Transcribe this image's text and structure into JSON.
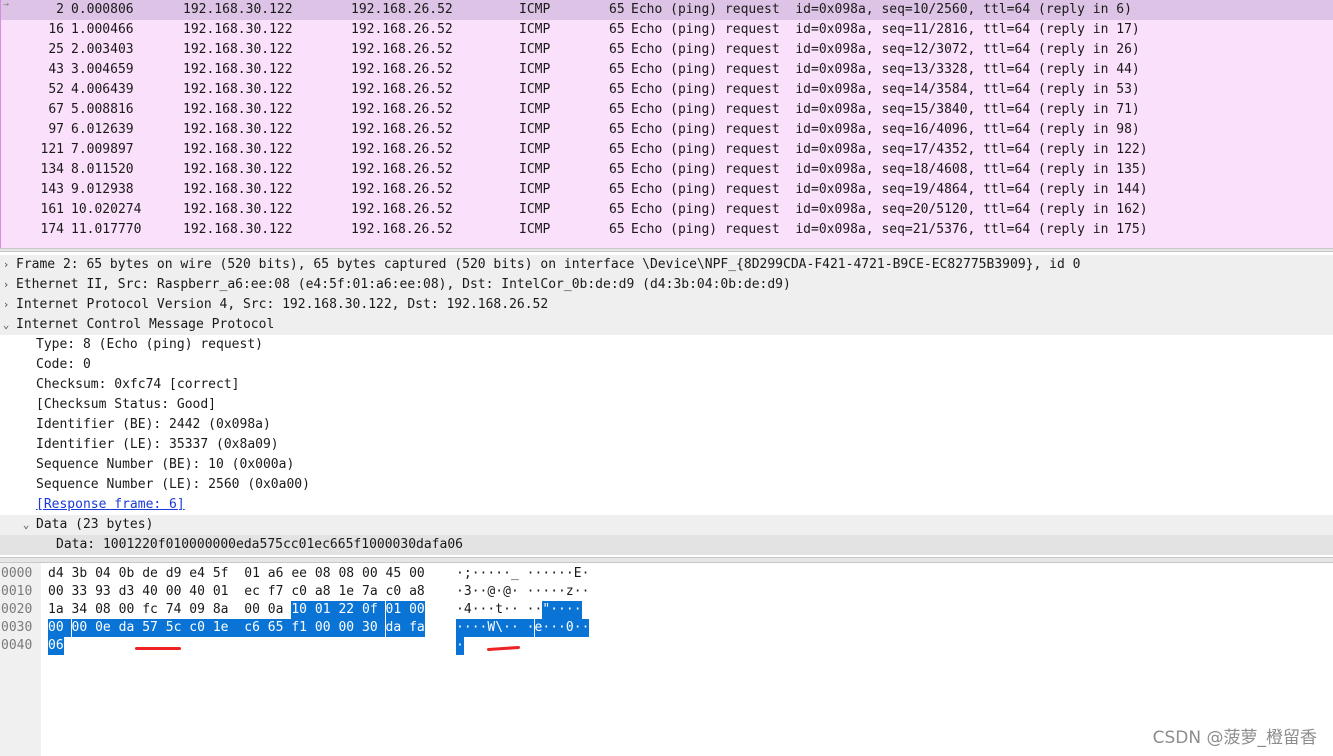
{
  "packets": [
    {
      "no": "2",
      "time": "0.000806",
      "src": "192.168.30.122",
      "dst": "192.168.26.52",
      "proto": "ICMP",
      "len": "65",
      "info": "Echo (ping) request  id=0x098a, seq=10/2560, ttl=64 (reply in 6)",
      "selected": true
    },
    {
      "no": "16",
      "time": "1.000466",
      "src": "192.168.30.122",
      "dst": "192.168.26.52",
      "proto": "ICMP",
      "len": "65",
      "info": "Echo (ping) request  id=0x098a, seq=11/2816, ttl=64 (reply in 17)"
    },
    {
      "no": "25",
      "time": "2.003403",
      "src": "192.168.30.122",
      "dst": "192.168.26.52",
      "proto": "ICMP",
      "len": "65",
      "info": "Echo (ping) request  id=0x098a, seq=12/3072, ttl=64 (reply in 26)"
    },
    {
      "no": "43",
      "time": "3.004659",
      "src": "192.168.30.122",
      "dst": "192.168.26.52",
      "proto": "ICMP",
      "len": "65",
      "info": "Echo (ping) request  id=0x098a, seq=13/3328, ttl=64 (reply in 44)"
    },
    {
      "no": "52",
      "time": "4.006439",
      "src": "192.168.30.122",
      "dst": "192.168.26.52",
      "proto": "ICMP",
      "len": "65",
      "info": "Echo (ping) request  id=0x098a, seq=14/3584, ttl=64 (reply in 53)"
    },
    {
      "no": "67",
      "time": "5.008816",
      "src": "192.168.30.122",
      "dst": "192.168.26.52",
      "proto": "ICMP",
      "len": "65",
      "info": "Echo (ping) request  id=0x098a, seq=15/3840, ttl=64 (reply in 71)"
    },
    {
      "no": "97",
      "time": "6.012639",
      "src": "192.168.30.122",
      "dst": "192.168.26.52",
      "proto": "ICMP",
      "len": "65",
      "info": "Echo (ping) request  id=0x098a, seq=16/4096, ttl=64 (reply in 98)"
    },
    {
      "no": "121",
      "time": "7.009897",
      "src": "192.168.30.122",
      "dst": "192.168.26.52",
      "proto": "ICMP",
      "len": "65",
      "info": "Echo (ping) request  id=0x098a, seq=17/4352, ttl=64 (reply in 122)"
    },
    {
      "no": "134",
      "time": "8.011520",
      "src": "192.168.30.122",
      "dst": "192.168.26.52",
      "proto": "ICMP",
      "len": "65",
      "info": "Echo (ping) request  id=0x098a, seq=18/4608, ttl=64 (reply in 135)"
    },
    {
      "no": "143",
      "time": "9.012938",
      "src": "192.168.30.122",
      "dst": "192.168.26.52",
      "proto": "ICMP",
      "len": "65",
      "info": "Echo (ping) request  id=0x098a, seq=19/4864, ttl=64 (reply in 144)"
    },
    {
      "no": "161",
      "time": "10.020274",
      "src": "192.168.30.122",
      "dst": "192.168.26.52",
      "proto": "ICMP",
      "len": "65",
      "info": "Echo (ping) request  id=0x098a, seq=20/5120, ttl=64 (reply in 162)"
    },
    {
      "no": "174",
      "time": "11.017770",
      "src": "192.168.30.122",
      "dst": "192.168.26.52",
      "proto": "ICMP",
      "len": "65",
      "info": "Echo (ping) request  id=0x098a, seq=21/5376, ttl=64 (reply in 175)"
    }
  ],
  "details": [
    {
      "text": "Frame 2: 65 bytes on wire (520 bits), 65 bytes captured (520 bits) on interface \\Device\\NPF_{8D299CDA-F421-4721-B9CE-EC82775B3909}, id 0",
      "level": 0,
      "toggle": ">",
      "hl": true
    },
    {
      "text": "Ethernet II, Src: Raspberr_a6:ee:08 (e4:5f:01:a6:ee:08), Dst: IntelCor_0b:de:d9 (d4:3b:04:0b:de:d9)",
      "level": 0,
      "toggle": ">",
      "hl": true
    },
    {
      "text": "Internet Protocol Version 4, Src: 192.168.30.122, Dst: 192.168.26.52",
      "level": 0,
      "toggle": ">",
      "hl": true
    },
    {
      "text": "Internet Control Message Protocol",
      "level": 0,
      "toggle": "v",
      "hl": true
    },
    {
      "text": "Type: 8 (Echo (ping) request)",
      "level": 1
    },
    {
      "text": "Code: 0",
      "level": 1
    },
    {
      "text": "Checksum: 0xfc74 [correct]",
      "level": 1
    },
    {
      "text": "[Checksum Status: Good]",
      "level": 1
    },
    {
      "text": "Identifier (BE): 2442 (0x098a)",
      "level": 1
    },
    {
      "text": "Identifier (LE): 35337 (0x8a09)",
      "level": 1
    },
    {
      "text": "Sequence Number (BE): 10 (0x000a)",
      "level": 1
    },
    {
      "text": "Sequence Number (LE): 2560 (0x0a00)",
      "level": 1
    },
    {
      "text": "[Response frame: 6]",
      "level": 1,
      "link": true
    },
    {
      "text": "Data (23 bytes)",
      "level": 1,
      "toggle": "v",
      "hl": true
    },
    {
      "text": "Data: 1001220f010000000eda575cc01ec665f1000030dafa06",
      "level": 2,
      "sel": true
    }
  ],
  "hex": [
    {
      "offset": "0000",
      "bytes": [
        "d4",
        "3b",
        "04",
        "0b",
        "de",
        "d9",
        "e4",
        "5f",
        "01",
        "a6",
        "ee",
        "08",
        "08",
        "00",
        "45",
        "00"
      ],
      "ascii": "·;·····_ ······E·",
      "selFrom": 99
    },
    {
      "offset": "0010",
      "bytes": [
        "00",
        "33",
        "93",
        "d3",
        "40",
        "00",
        "40",
        "01",
        "ec",
        "f7",
        "c0",
        "a8",
        "1e",
        "7a",
        "c0",
        "a8"
      ],
      "ascii": "·3··@·@· ·····z··",
      "selFrom": 99
    },
    {
      "offset": "0020",
      "bytes": [
        "1a",
        "34",
        "08",
        "00",
        "fc",
        "74",
        "09",
        "8a",
        "00",
        "0a",
        "10",
        "01",
        "22",
        "0f",
        "01",
        "00"
      ],
      "ascii": "·4···t·· ··\"····",
      "selFrom": 10
    },
    {
      "offset": "0030",
      "bytes": [
        "00",
        "00",
        "0e",
        "da",
        "57",
        "5c",
        "c0",
        "1e",
        "c6",
        "65",
        "f1",
        "00",
        "00",
        "30",
        "da",
        "fa"
      ],
      "ascii": "····W\\·· ·e···0··",
      "selFrom": 0
    },
    {
      "offset": "0040",
      "bytes": [
        "06"
      ],
      "ascii": "·",
      "selFrom": 0
    }
  ],
  "watermark": "CSDN @菠萝_橙留香",
  "colors": {
    "row_bg": "#fbe0fb",
    "row_selected": "#ddc3e6",
    "hex_selection": "#0a74d6",
    "annotation": "#e22222"
  }
}
